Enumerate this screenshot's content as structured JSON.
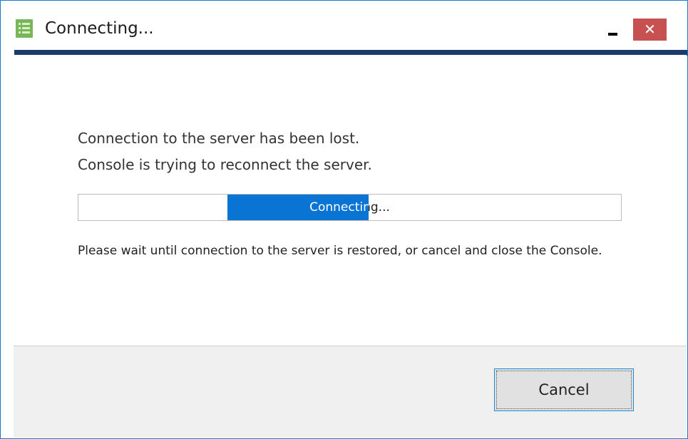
{
  "window": {
    "title": "Connecting...",
    "minimize_icon": "minimize-icon",
    "close_label": "✕",
    "accent_color": "#1c3a6a",
    "close_color": "#c75050"
  },
  "content": {
    "message_line1": "Connection to the server has been lost.",
    "message_line2": "Console is trying to reconnect the server.",
    "progress": {
      "label": "Connecting...",
      "fill_start": 0.275,
      "fill_end": 0.535,
      "fill_color": "#0a74d4"
    },
    "wait_text": "Please wait until connection to the server is restored, or cancel and close the Console."
  },
  "footer": {
    "cancel_label": "Cancel"
  }
}
